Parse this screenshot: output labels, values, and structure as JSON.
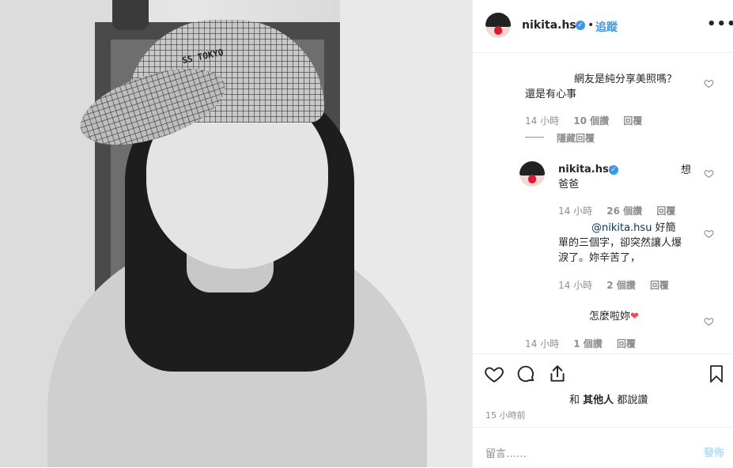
{
  "post": {
    "username": "nikita.hsu",
    "follow_label": "追蹤",
    "dot": "•",
    "more_label": "•••",
    "cap_text": "SS TOKYO"
  },
  "comments": [
    {
      "text_line1": "網友是純分享美照嗎？",
      "text_line2": "還是有心事",
      "time": "14 小時",
      "likes": "10 個讚",
      "reply": "回覆",
      "hide_replies": "隱藏回覆"
    },
    {
      "username": "nikita.hsu",
      "text_a": "想",
      "text_b": "爸爸",
      "time": "14 小時",
      "likes": "26 個讚",
      "reply": "回覆"
    },
    {
      "mention": "@nikita.hsu",
      "text_line1": "好簡",
      "text_line2": "單的三個字，卻突然讓人爆",
      "text_line3": "淚了。妳辛苦了，",
      "time": "14 小時",
      "likes": "2 個讚",
      "reply": "回覆"
    },
    {
      "text": "怎麼啦妳",
      "heart": "❤",
      "time": "14 小時",
      "likes": "1 個讚",
      "reply": "回覆"
    }
  ],
  "likes_line": {
    "prefix": "和",
    "bold": "其他人",
    "suffix": "都說讚"
  },
  "timestamp": "15 小時前",
  "comment_input": {
    "placeholder": "留言……",
    "post_label": "發佈"
  },
  "colors": {
    "accent": "#3897f0",
    "muted": "#8e8e8e",
    "text": "#262626",
    "mention": "#003569"
  }
}
